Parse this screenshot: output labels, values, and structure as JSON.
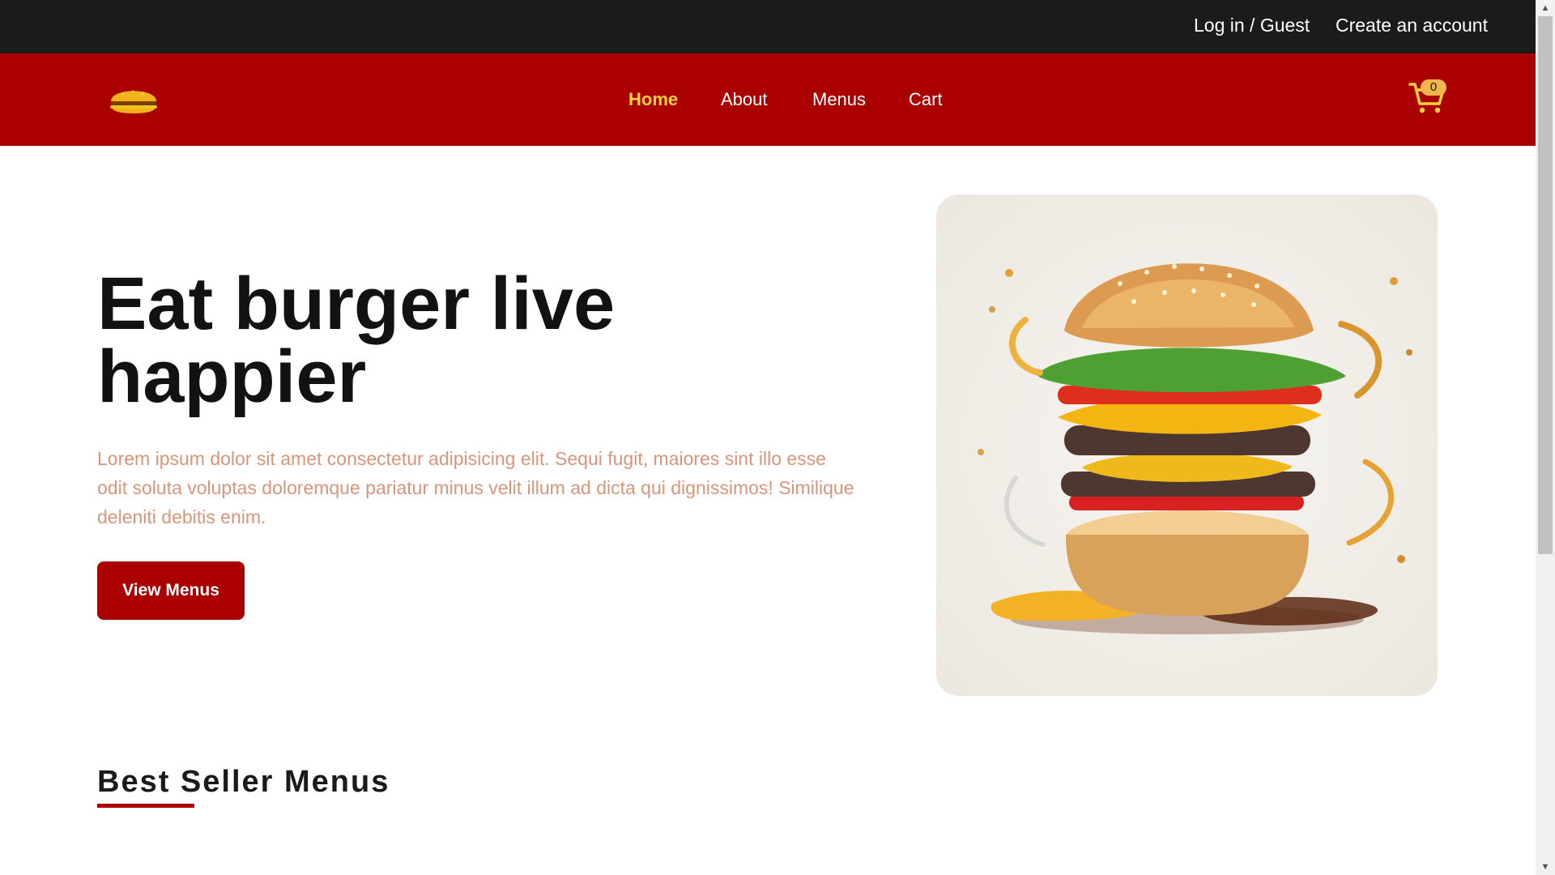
{
  "topbar": {
    "login_label": "Log in / Guest",
    "create_account_label": "Create an account"
  },
  "nav": {
    "logo_icon": "burger-logo-icon",
    "items": [
      {
        "label": "Home",
        "active": true
      },
      {
        "label": "About",
        "active": false
      },
      {
        "label": "Menus",
        "active": false
      },
      {
        "label": "Cart",
        "active": false
      }
    ],
    "cart_icon": "shopping-cart-icon",
    "cart_count": "0"
  },
  "hero": {
    "title_line1": "Eat burger live",
    "title_line2": "happier",
    "description": "Lorem ipsum dolor sit amet consectetur adipisicing elit. Sequi fugit, maiores sint illo esse odit soluta voluptas doloremque pariatur minus velit illum ad dicta qui dignissimos! Similique deleniti debitis enim.",
    "button_label": "View Menus"
  },
  "section": {
    "title": "Best Seller Menus"
  },
  "colors": {
    "topbar": "#1b1b1b",
    "brand_red": "#ab0000",
    "active_nav": "#ffd23a",
    "hero_text": "#d9957a"
  }
}
